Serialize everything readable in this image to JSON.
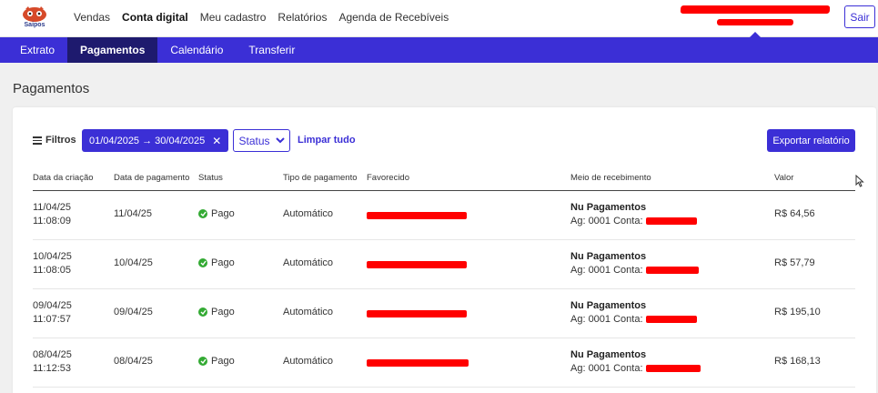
{
  "app": {
    "logo_name": "Saipos"
  },
  "topnav": [
    {
      "label": "Vendas",
      "active": false
    },
    {
      "label": "Conta digital",
      "active": true
    },
    {
      "label": "Meu cadastro",
      "active": false
    },
    {
      "label": "Relatórios",
      "active": false
    },
    {
      "label": "Agenda de Recebíveis",
      "active": false
    }
  ],
  "header": {
    "logout_label": "Sair"
  },
  "subnav": [
    {
      "label": "Extrato",
      "active": false
    },
    {
      "label": "Pagamentos",
      "active": true
    },
    {
      "label": "Calendário",
      "active": false
    },
    {
      "label": "Transferir",
      "active": false
    }
  ],
  "page": {
    "title": "Pagamentos"
  },
  "filters": {
    "filters_label": "Filtros",
    "date_range": "01/04/2025 → 30/04/2025",
    "status_label": "Status",
    "clear_label": "Limpar tudo",
    "export_label": "Exportar relatório"
  },
  "table": {
    "headers": [
      "Data da criação",
      "Data de pagamento",
      "Status",
      "Tipo de pagamento",
      "Favorecido",
      "Meio de recebimento",
      "Valor"
    ],
    "rows": [
      {
        "created_date": "11/04/25",
        "created_time": "11:08:09",
        "payment_date": "11/04/25",
        "status": "Pago",
        "type": "Automático",
        "bank": "Nu Pagamentos",
        "account": "Ag: 0001 Conta:",
        "value": "R$ 64,56"
      },
      {
        "created_date": "10/04/25",
        "created_time": "11:08:05",
        "payment_date": "10/04/25",
        "status": "Pago",
        "type": "Automático",
        "bank": "Nu Pagamentos",
        "account": "Ag: 0001 Conta:",
        "value": "R$ 57,79"
      },
      {
        "created_date": "09/04/25",
        "created_time": "11:07:57",
        "payment_date": "09/04/25",
        "status": "Pago",
        "type": "Automático",
        "bank": "Nu Pagamentos",
        "account": "Ag: 0001 Conta:",
        "value": "R$ 195,10"
      },
      {
        "created_date": "08/04/25",
        "created_time": "11:12:53",
        "payment_date": "08/04/25",
        "status": "Pago",
        "type": "Automático",
        "bank": "Nu Pagamentos",
        "account": "Ag: 0001 Conta:",
        "value": "R$ 168,13"
      }
    ]
  },
  "colors": {
    "accent": "#3b2fd6",
    "active_tab": "#1e1a6e",
    "success": "#33aa33",
    "redaction": "#ff0000"
  },
  "icons": [
    "saipos-logo-icon",
    "menu-lines-icon",
    "close-icon",
    "chevron-down-icon",
    "check-circle-icon",
    "mouse-cursor-icon"
  ]
}
